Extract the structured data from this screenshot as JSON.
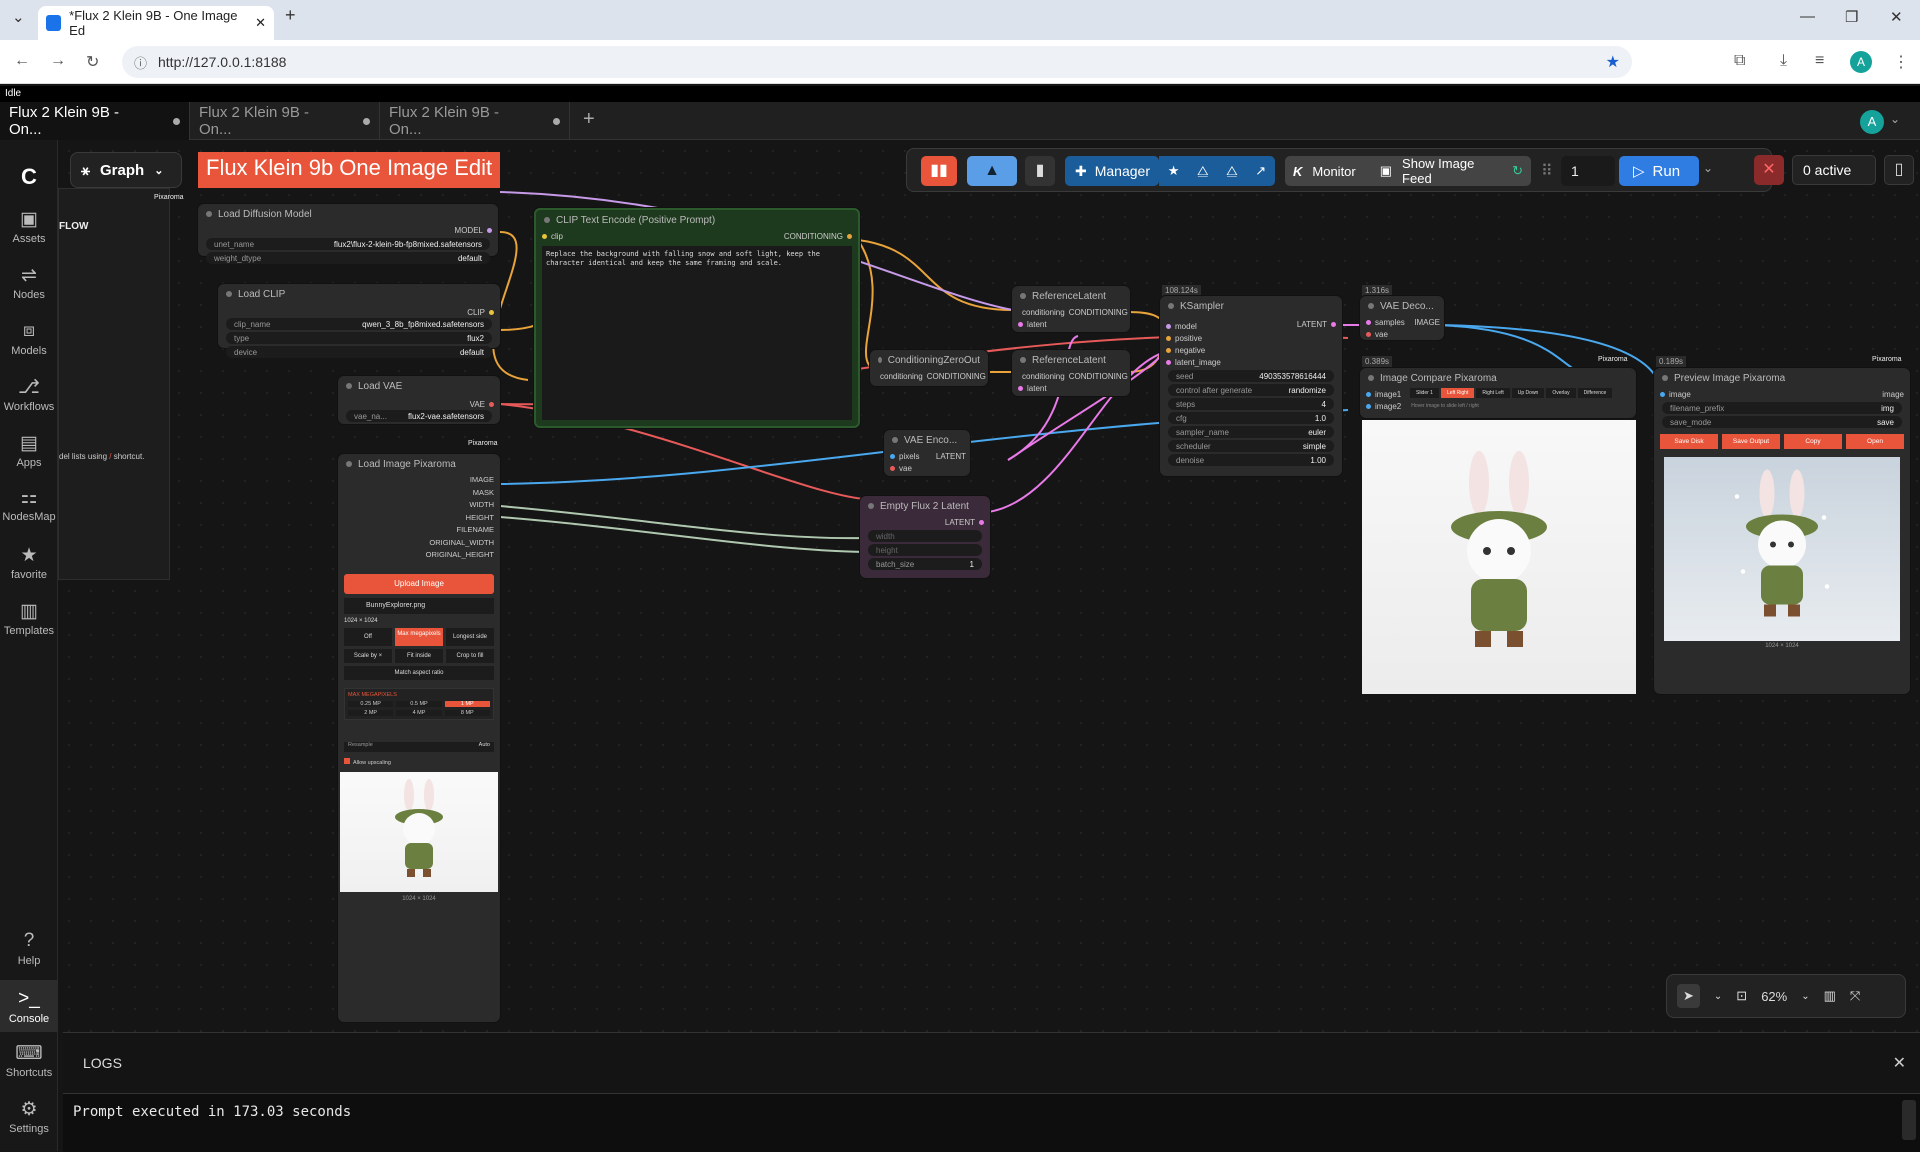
{
  "browser": {
    "tab_title": "*Flux 2 Klein 9B - One Image Ed",
    "url": "http://127.0.0.1:8188",
    "avatar": "A"
  },
  "status": "Idle",
  "tabs": [
    {
      "label": "Flux 2 Klein 9B - On..."
    },
    {
      "label": "Flux 2 Klein 9B - On..."
    },
    {
      "label": "Flux 2 Klein 9B - On..."
    }
  ],
  "user_avatar": "A",
  "sidebar": [
    {
      "label": "Assets"
    },
    {
      "label": "Nodes"
    },
    {
      "label": "Models"
    },
    {
      "label": "Workflows"
    },
    {
      "label": "Apps"
    },
    {
      "label": "NodesMap"
    },
    {
      "label": "favorite"
    },
    {
      "label": "Templates"
    },
    {
      "label": "Help"
    },
    {
      "label": "Console"
    },
    {
      "label": "Shortcuts"
    },
    {
      "label": "Settings"
    }
  ],
  "toolbar": {
    "graph": "Graph",
    "title": "Flux Klein 9b One Image Edit",
    "manager": "Manager",
    "monitor": "Monitor",
    "feed": "Show Image Feed",
    "queue": "1",
    "run": "Run",
    "active": "0 active",
    "pixaroma": "Pixaroma"
  },
  "panel": {
    "flow": "FLOW",
    "hint": "del lists using",
    "hint2": "shortcut."
  },
  "nodes": {
    "load_diffusion": {
      "title": "Load Diffusion Model",
      "out": "MODEL",
      "unet_label": "unet_name",
      "unet": "flux2\\flux-2-klein-9b-fp8mixed.safetensors",
      "dtype_label": "weight_dtype",
      "dtype": "default"
    },
    "load_clip": {
      "title": "Load CLIP",
      "out": "CLIP",
      "clip_label": "clip_name",
      "clip": "qwen_3_8b_fp8mixed.safetensors",
      "type_label": "type",
      "type": "flux2",
      "device_label": "device",
      "device": "default"
    },
    "load_vae": {
      "title": "Load VAE",
      "out": "VAE",
      "vae_label": "vae_na...",
      "vae": "flux2-vae.safetensors"
    },
    "clip_text": {
      "title": "CLIP Text Encode (Positive Prompt)",
      "in": "clip",
      "out": "CONDITIONING",
      "prompt": "Replace the background with falling snow and soft light, keep the character identical and keep the same framing and scale."
    },
    "zero_out": {
      "title": "ConditioningZeroOut",
      "in": "conditioning",
      "out": "CONDITIONING"
    },
    "ref1": {
      "title": "ReferenceLatent",
      "in1": "conditioning",
      "in2": "latent",
      "out": "CONDITIONING"
    },
    "ref2": {
      "title": "ReferenceLatent",
      "in1": "conditioning",
      "in2": "latent",
      "out": "CONDITIONING"
    },
    "ksampler": {
      "time": "108.124s",
      "title": "KSampler",
      "ins": [
        "model",
        "positive",
        "negative",
        "latent_image"
      ],
      "out": "LATENT",
      "widgets": [
        {
          "k": "seed",
          "v": "490353578616444"
        },
        {
          "k": "control after generate",
          "v": "randomize"
        },
        {
          "k": "steps",
          "v": "4"
        },
        {
          "k": "cfg",
          "v": "1.0"
        },
        {
          "k": "sampler_name",
          "v": "euler"
        },
        {
          "k": "scheduler",
          "v": "simple"
        },
        {
          "k": "denoise",
          "v": "1.00"
        }
      ]
    },
    "vae_decode": {
      "time": "1.316s",
      "title": "VAE Deco...",
      "in1": "samples",
      "in2": "vae",
      "out": "IMAGE"
    },
    "vae_encode": {
      "title": "VAE Enco...",
      "in1": "pixels",
      "in2": "vae",
      "out": "LATENT"
    },
    "empty_latent": {
      "title": "Empty Flux 2 Latent",
      "out": "LATENT",
      "w": "width",
      "h": "height",
      "bs_label": "batch_size",
      "bs": "1"
    },
    "load_image": {
      "title": "Load Image Pixaroma",
      "outs": [
        "IMAGE",
        "MASK",
        "WIDTH",
        "HEIGHT",
        "FILENAME",
        "ORIGINAL_WIDTH",
        "ORIGINAL_HEIGHT"
      ],
      "upload": "Upload Image",
      "file": "BunnyExplorer.png",
      "size": "1024 × 1024",
      "modes": [
        "Off",
        "Max megapixels",
        "Longest side",
        "Scale by ×",
        "Fit inside",
        "Crop to fill",
        "Match aspect ratio"
      ],
      "mp_label": "MAX MEGAPIXELS",
      "mps": [
        "0.25 MP",
        "0.5 MP",
        "1 MP",
        "2 MP",
        "4 MP",
        "8 MP"
      ],
      "resample": "Resample",
      "resample_v": "Auto",
      "allow": "Allow upscaling",
      "caption": "1024 × 1024"
    },
    "compare": {
      "time": "0.389s",
      "title": "Image Compare Pixaroma",
      "in1": "image1",
      "in2": "image2",
      "hint": "Hover image to slide left / right",
      "modes": [
        "Slider 1",
        "Left Right",
        "Right Left",
        "Up Down",
        "Overlay",
        "Difference"
      ]
    },
    "preview": {
      "time": "0.189s",
      "title": "Preview Image Pixaroma",
      "in": "image",
      "out": "image",
      "prefix_label": "filename_prefix",
      "prefix": "img",
      "save_label": "save_mode",
      "save": "save",
      "buttons": [
        "Save Disk",
        "Save Output",
        "Copy",
        "Open"
      ],
      "caption": "1024 × 1024"
    }
  },
  "zoom": "62%",
  "logs": {
    "title": "LOGS",
    "line": "Prompt executed in 173.03 seconds"
  }
}
